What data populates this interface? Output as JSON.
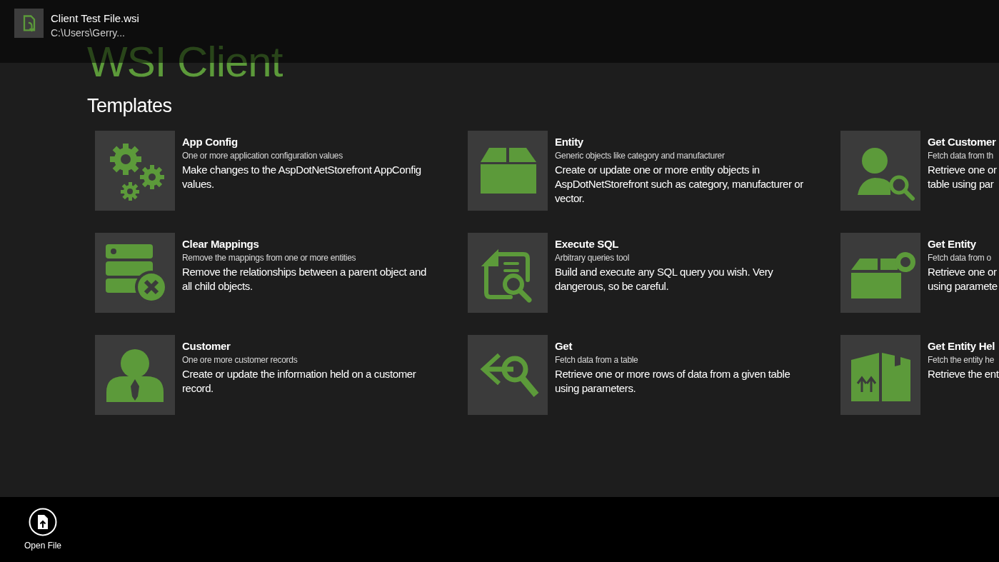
{
  "file": {
    "name": "Client Test File.wsi",
    "path": "C:\\Users\\Gerry..."
  },
  "app_title": "WSI Client",
  "section_title": "Templates",
  "templates": [
    {
      "title": "App Config",
      "subtitle": "One or more application configuration values",
      "description_lines": [
        "Make changes to the AspDotNetStorefront AppConfig",
        "values."
      ]
    },
    {
      "title": "Entity",
      "subtitle": "Generic objects like category and manufacturer",
      "description_lines": [
        "Create or update one or more entity objects in",
        "AspDotNetStorefront such as category, manufacturer or",
        "vector."
      ]
    },
    {
      "title": "Get Customer",
      "subtitle": "Fetch data from th",
      "description_lines": [
        "Retrieve one or",
        "table using par"
      ]
    },
    {
      "title": "Clear Mappings",
      "subtitle": "Remove the mappings from one or more entities",
      "description_lines": [
        "Remove the relationships between a parent object and",
        "all child objects."
      ]
    },
    {
      "title": "Execute SQL",
      "subtitle": "Arbitrary queries tool",
      "description_lines": [
        "Build and execute any SQL query you wish. Very",
        "dangerous, so be careful."
      ]
    },
    {
      "title": "Get Entity",
      "subtitle": "Fetch data from o",
      "description_lines": [
        "Retrieve one or",
        "using paramete"
      ]
    },
    {
      "title": "Customer",
      "subtitle": "One ore more customer records",
      "description_lines": [
        "Create or update the information held on a customer",
        "record."
      ]
    },
    {
      "title": "Get",
      "subtitle": "Fetch data from a table",
      "description_lines": [
        "Retrieve one or more rows of data from a given table",
        "using parameters."
      ]
    },
    {
      "title": "Get Entity Hel",
      "subtitle": "Fetch the entity he",
      "description_lines": [
        "Retrieve the ent"
      ]
    }
  ],
  "app_bar": {
    "buttons": [
      {
        "label": "Open File"
      }
    ]
  }
}
